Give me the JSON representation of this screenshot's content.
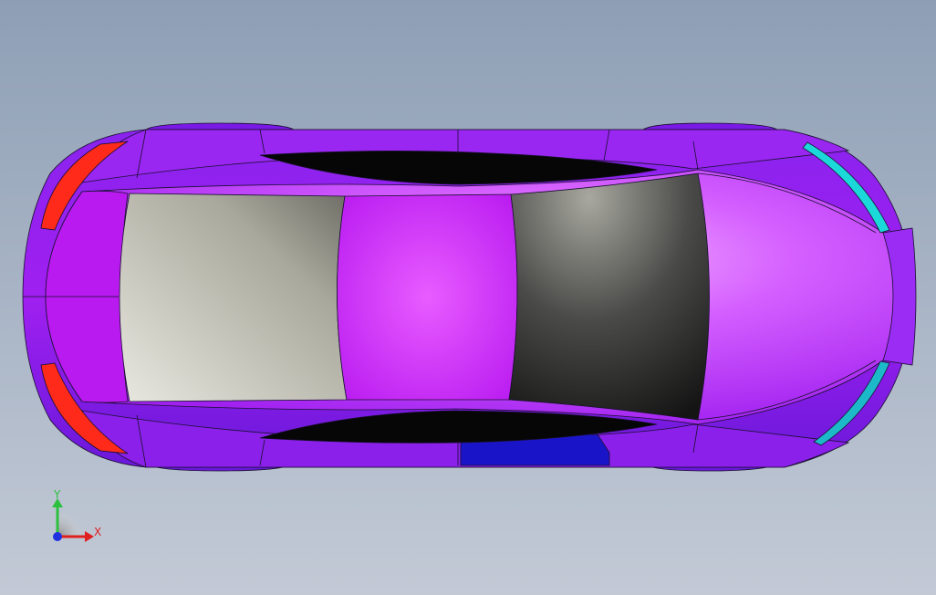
{
  "viewport": {
    "background_top": "#8e9fb5",
    "background_bottom": "#c3cad6"
  },
  "model": {
    "body_color": "#b515f5",
    "body_dark": "#7a19e6",
    "body_light": "#e07cff",
    "tail_light_color": "#ff2a1a",
    "head_light_color": "#1cd9d9",
    "rocker_blue": "#1a14c8",
    "edge_color": "#1a1030"
  },
  "triad": {
    "x_label": "X",
    "y_label": "Y",
    "x_color": "#e02020",
    "y_color": "#2cc040",
    "z_color": "#2030e0"
  }
}
